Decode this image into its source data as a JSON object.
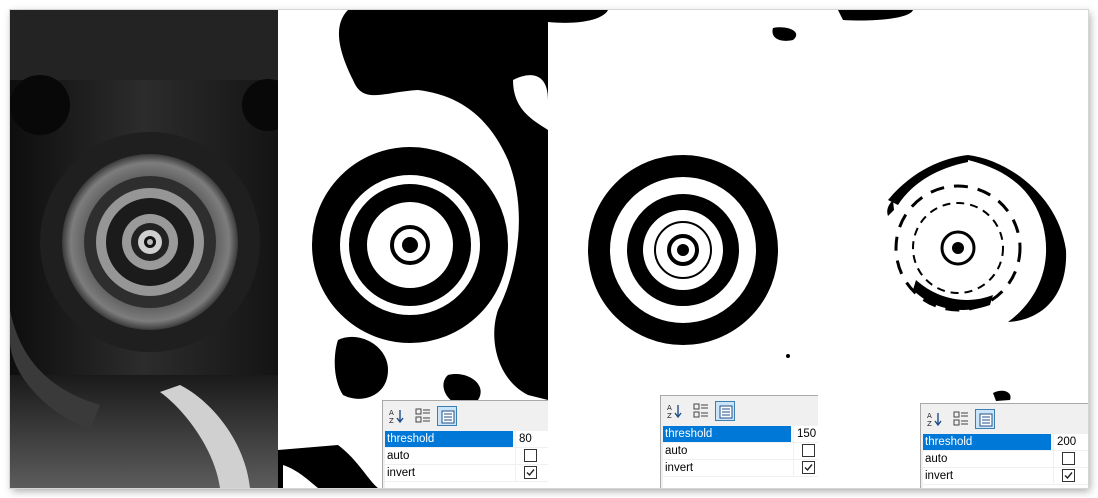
{
  "panels": [
    {
      "id": "original",
      "tonal": true
    },
    {
      "id": "threshold-80",
      "props": {
        "rows": [
          {
            "name": "threshold",
            "value": "80",
            "kind": "text",
            "selected": true
          },
          {
            "name": "auto",
            "checked": false,
            "kind": "check"
          },
          {
            "name": "invert",
            "checked": true,
            "kind": "check"
          }
        ]
      }
    },
    {
      "id": "threshold-150",
      "props": {
        "rows": [
          {
            "name": "threshold",
            "value": "150",
            "kind": "text",
            "selected": true
          },
          {
            "name": "auto",
            "checked": false,
            "kind": "check"
          },
          {
            "name": "invert",
            "checked": true,
            "kind": "check"
          }
        ]
      }
    },
    {
      "id": "threshold-200",
      "props": {
        "rows": [
          {
            "name": "threshold",
            "value": "200",
            "kind": "text",
            "selected": true
          },
          {
            "name": "auto",
            "checked": false,
            "kind": "check"
          },
          {
            "name": "invert",
            "checked": true,
            "kind": "check"
          }
        ]
      }
    }
  ],
  "toolbar_icons": [
    "sort-alphabetical-icon",
    "categorized-icon",
    "property-pages-icon"
  ],
  "colors": {
    "selection": "#0078d7",
    "grid_background": "#f0f0f0",
    "active_button": "#cce4f7"
  }
}
